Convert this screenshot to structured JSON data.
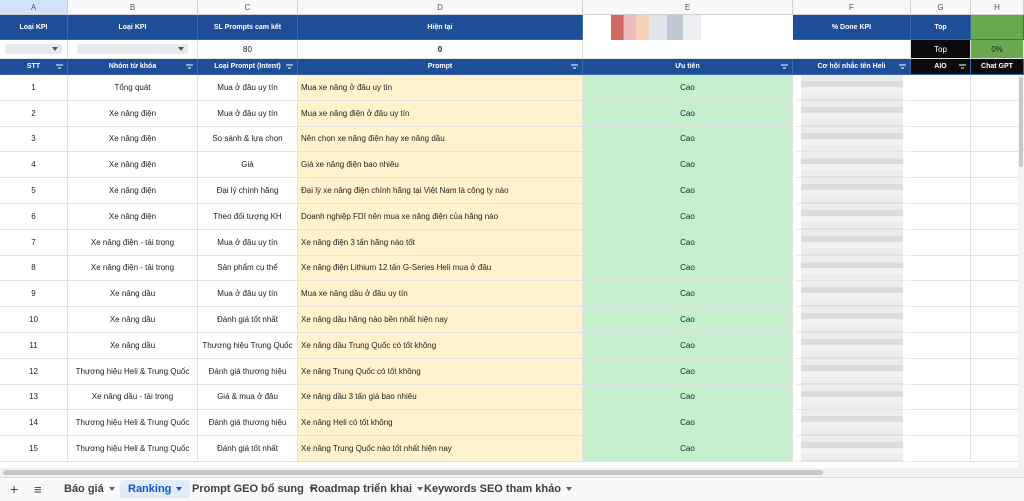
{
  "column_letters": [
    "A",
    "B",
    "C",
    "D",
    "E",
    "F",
    "G",
    "H"
  ],
  "header1": {
    "kpi_type": "Loại KPI",
    "kpi_type2": "Loại KPI",
    "sl_prompts": "SL Prompts cam kết",
    "current": "Hiện tại",
    "done_kpi": "% Done KPI",
    "top": "Top"
  },
  "kpi_row": {
    "sl_value": "80",
    "current_value": "0",
    "top_label": "Top",
    "percent": "0%"
  },
  "header2": {
    "stt": "STT",
    "keyword_group": "Nhóm từ khóa",
    "prompt_type": "Loại Prompt (Intent)",
    "prompt": "Prompt",
    "priority": "Ưu tiên",
    "opportunity": "Cơ hội nhắc tên Heli",
    "aio": "AIO",
    "chatgpt": "Chat GPT"
  },
  "rows": [
    {
      "stt": "1",
      "group": "Tổng quát",
      "type": "Mua ở đâu uy tín",
      "prompt": "Mua xe nâng ở đâu uy tín",
      "priority": "Cao"
    },
    {
      "stt": "2",
      "group": "Xe nâng điện",
      "type": "Mua ở đâu uy tín",
      "prompt": "Mua xe nâng điện ở đâu uy tín",
      "priority": "Cao"
    },
    {
      "stt": "3",
      "group": "Xe nâng điện",
      "type": "So sánh & lựa chọn",
      "prompt": "Nên chọn xe nâng điện hay xe nâng dầu",
      "priority": "Cao"
    },
    {
      "stt": "4",
      "group": "Xe nâng điện",
      "type": "Giá",
      "prompt": "Giá xe nâng điện bao nhiêu",
      "priority": "Cao"
    },
    {
      "stt": "5",
      "group": "Xe nâng điện",
      "type": "Đại lý chính hãng",
      "prompt": "Đại lý xe nâng điện chính hãng tại Việt Nam là công ty nào",
      "priority": "Cao"
    },
    {
      "stt": "6",
      "group": "Xe nâng điện",
      "type": "Theo đối tượng KH",
      "prompt": "Doanh nghiệp FDI nên mua xe nâng điện của hãng nào",
      "priority": "Cao"
    },
    {
      "stt": "7",
      "group": "Xe nâng điện - tải trọng",
      "type": "Mua ở đâu uy tín",
      "prompt": "Xe nâng điện 3 tấn hãng nào tốt",
      "priority": "Cao"
    },
    {
      "stt": "8",
      "group": "Xe nâng điện - tải trọng",
      "type": "Sản phẩm cụ thể",
      "prompt": "Xe nâng điện Lithium 12 tấn G-Series Heli mua ở đâu",
      "priority": "Cao"
    },
    {
      "stt": "9",
      "group": "Xe nâng dầu",
      "type": "Mua ở đâu uy tín",
      "prompt": "Mua xe nâng dầu ở đâu uy tín",
      "priority": "Cao"
    },
    {
      "stt": "10",
      "group": "Xe nâng dầu",
      "type": "Đánh giá tốt nhất",
      "prompt": "Xe nâng dầu hãng nào bền nhất hiện nay",
      "priority": "Cao"
    },
    {
      "stt": "11",
      "group": "Xe nâng dầu",
      "type": "Thương hiệu Trung Quốc",
      "prompt": "Xe nâng dầu Trung Quốc có tốt không",
      "priority": "Cao"
    },
    {
      "stt": "12",
      "group": "Thương hiệu Heli & Trung Quốc",
      "type": "Đánh giá thương hiệu",
      "prompt": "Xe nâng Trung Quốc có tốt không",
      "priority": "Cao"
    },
    {
      "stt": "13",
      "group": "Xe nâng dầu - tải trọng",
      "type": "Giá & mua ở đâu",
      "prompt": "Xe nâng dầu 3 tấn giá bao nhiêu",
      "priority": "Cao"
    },
    {
      "stt": "14",
      "group": "Thương hiệu Heli & Trung Quốc",
      "type": "Đánh giá thương hiệu",
      "prompt": "Xe nâng Heli có tốt không",
      "priority": "Cao"
    },
    {
      "stt": "15",
      "group": "Thương hiệu Heli & Trung Quốc",
      "type": "Đánh giá tốt nhất",
      "prompt": "Xe nâng Trung Quốc nào tốt nhất hiện nay",
      "priority": "Cao"
    }
  ],
  "tabs": [
    {
      "label": "Báo giá"
    },
    {
      "label": "Ranking"
    },
    {
      "label": "Prompt GEO bổ sung"
    },
    {
      "label": "Roadmap triển khai"
    },
    {
      "label": "Keywords SEO tham khảo"
    }
  ],
  "colors": {
    "header_navy": "#1f4e99",
    "prompt_bg": "#fff2cc",
    "priority_bg": "#c6efce",
    "tab_active": "#0b57d0"
  }
}
